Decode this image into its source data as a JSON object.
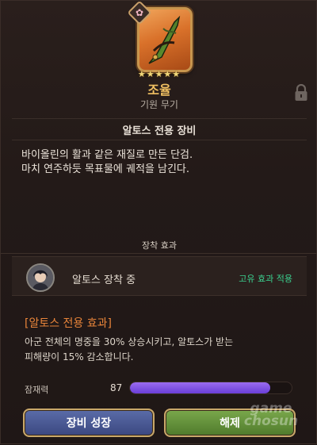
{
  "weapon": {
    "name": "조율",
    "type": "기원 무기",
    "stars": "★★★★★",
    "element_icon": "flower-icon",
    "owner_title": "알토스  전용 장비",
    "description_lines": [
      "바이올린의 활과 같은 재질로 만든 단검.",
      "마치 연주하듯 목표물에 궤적을 남긴다."
    ]
  },
  "equip_effect": {
    "section_title": "장착 효과",
    "equipped_label": "알토스 장착 중",
    "unique_effect_label": "고유 효과 적용"
  },
  "exclusive_effect": {
    "title": "[알토스 전용 효과]",
    "desc_lines": [
      "아군 전체의 명중을 30% 상승시키고, 알토스가 받는",
      "피해량이 15% 감소합니다."
    ]
  },
  "potential": {
    "label": "잠재력",
    "value": "87",
    "fill_fraction": 0.87
  },
  "buttons": {
    "upgrade": "장비 성장",
    "unequip": "해제"
  },
  "watermark": {
    "line1": "game",
    "line2": "chosun"
  },
  "colors": {
    "accent_gold": "#f0c062",
    "effect_orange": "#e8843a",
    "unique_green": "#3bcf8e",
    "potential_purple": "#8a5ce8"
  }
}
